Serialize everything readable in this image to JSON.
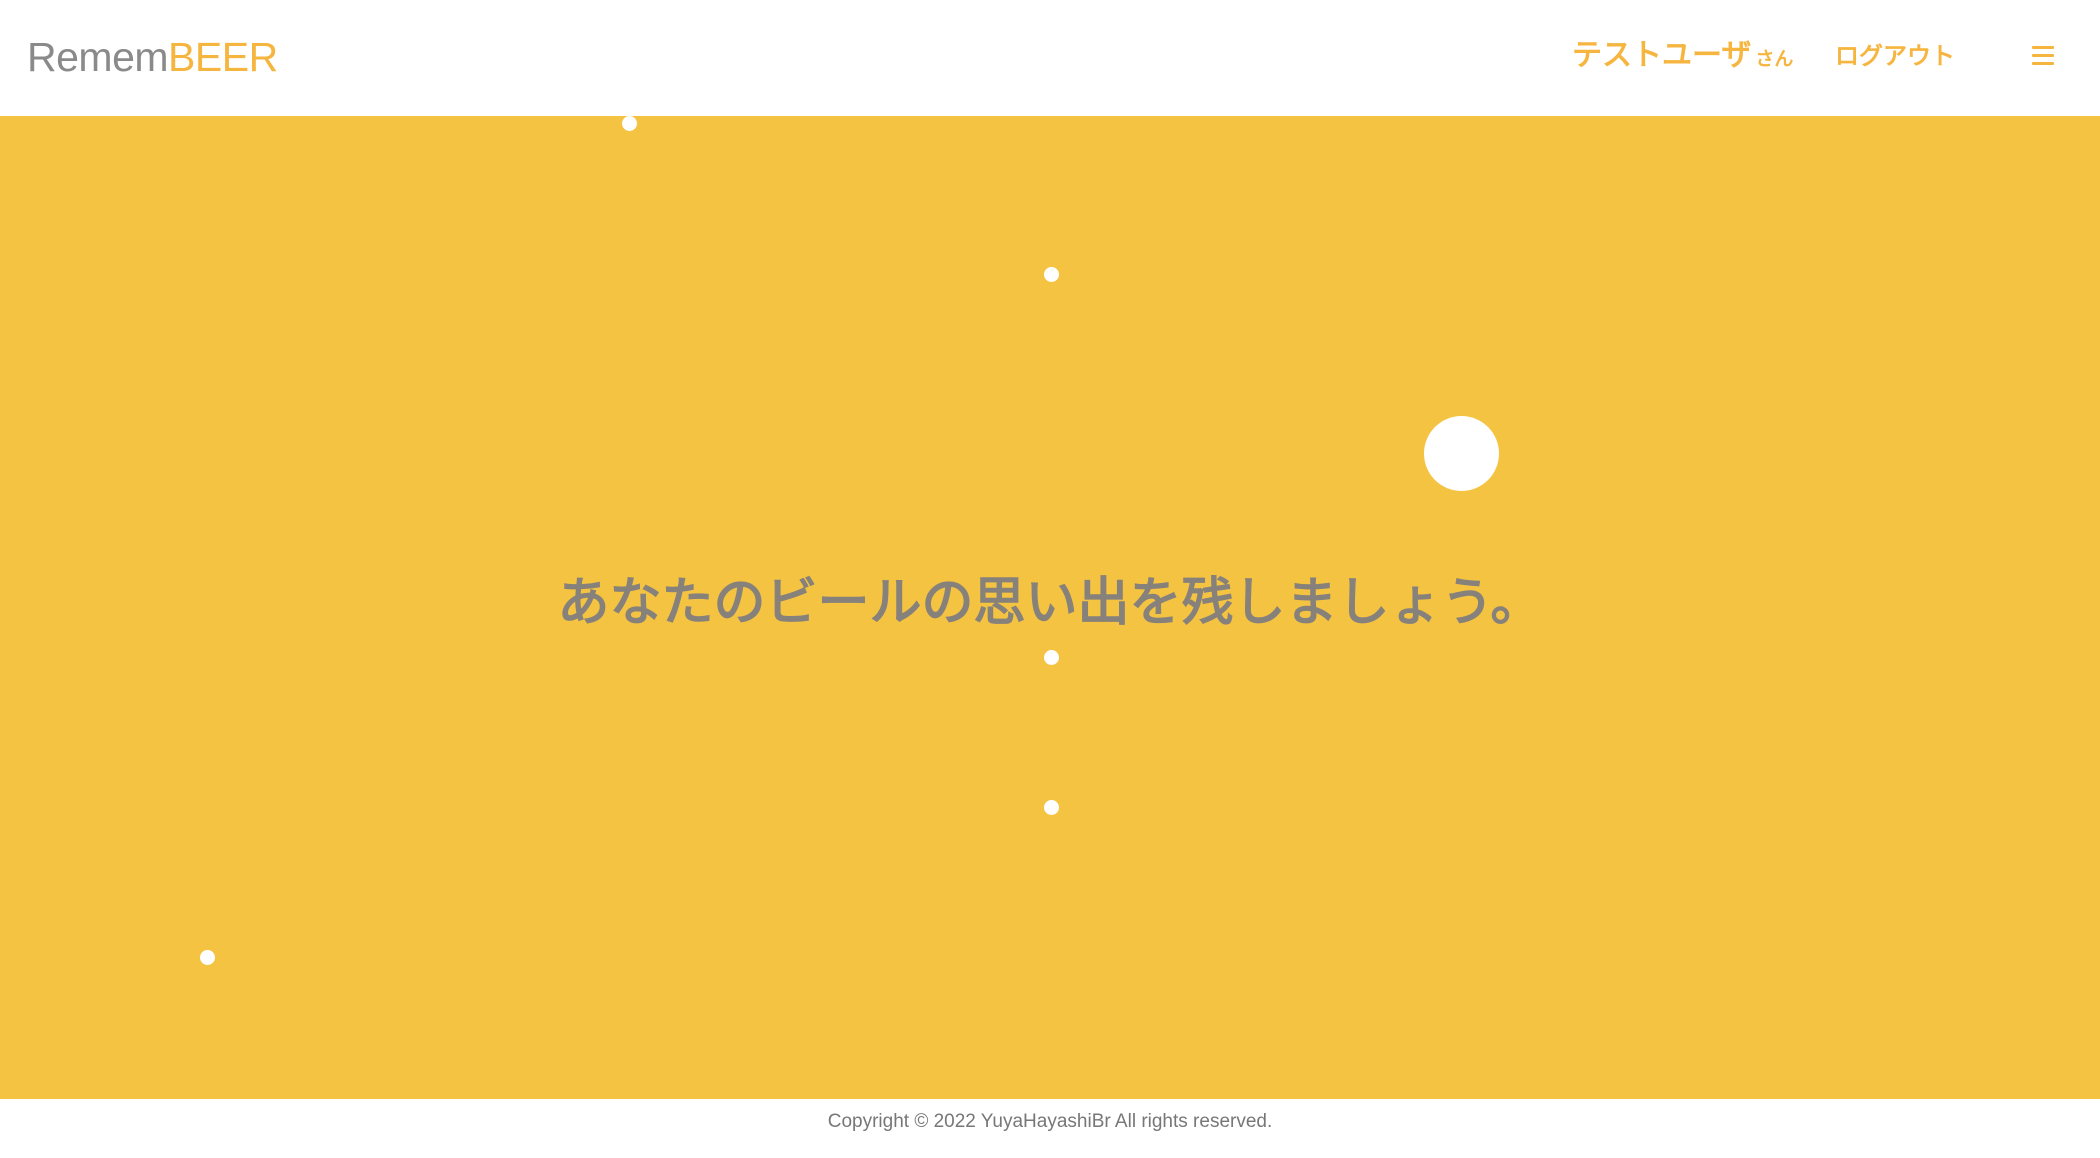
{
  "header": {
    "logo_part1": "Remem",
    "logo_part2": "BEER",
    "user_name": "テストユーザ",
    "user_suffix": "さん",
    "logout_label": "ログアウト",
    "menu_icon": "hamburger-menu-icon"
  },
  "hero": {
    "tagline": "あなたのビールの思い出を残しましょう。",
    "background_color": "#f4c342",
    "bubble_color": "#ffffff"
  },
  "footer": {
    "copyright": "Copyright © 2022 YuyaHayashiBr All rights reserved."
  },
  "colors": {
    "accent": "#f5b53f",
    "logo_gray": "#8a8a8a",
    "tagline_gray": "#86817b"
  }
}
